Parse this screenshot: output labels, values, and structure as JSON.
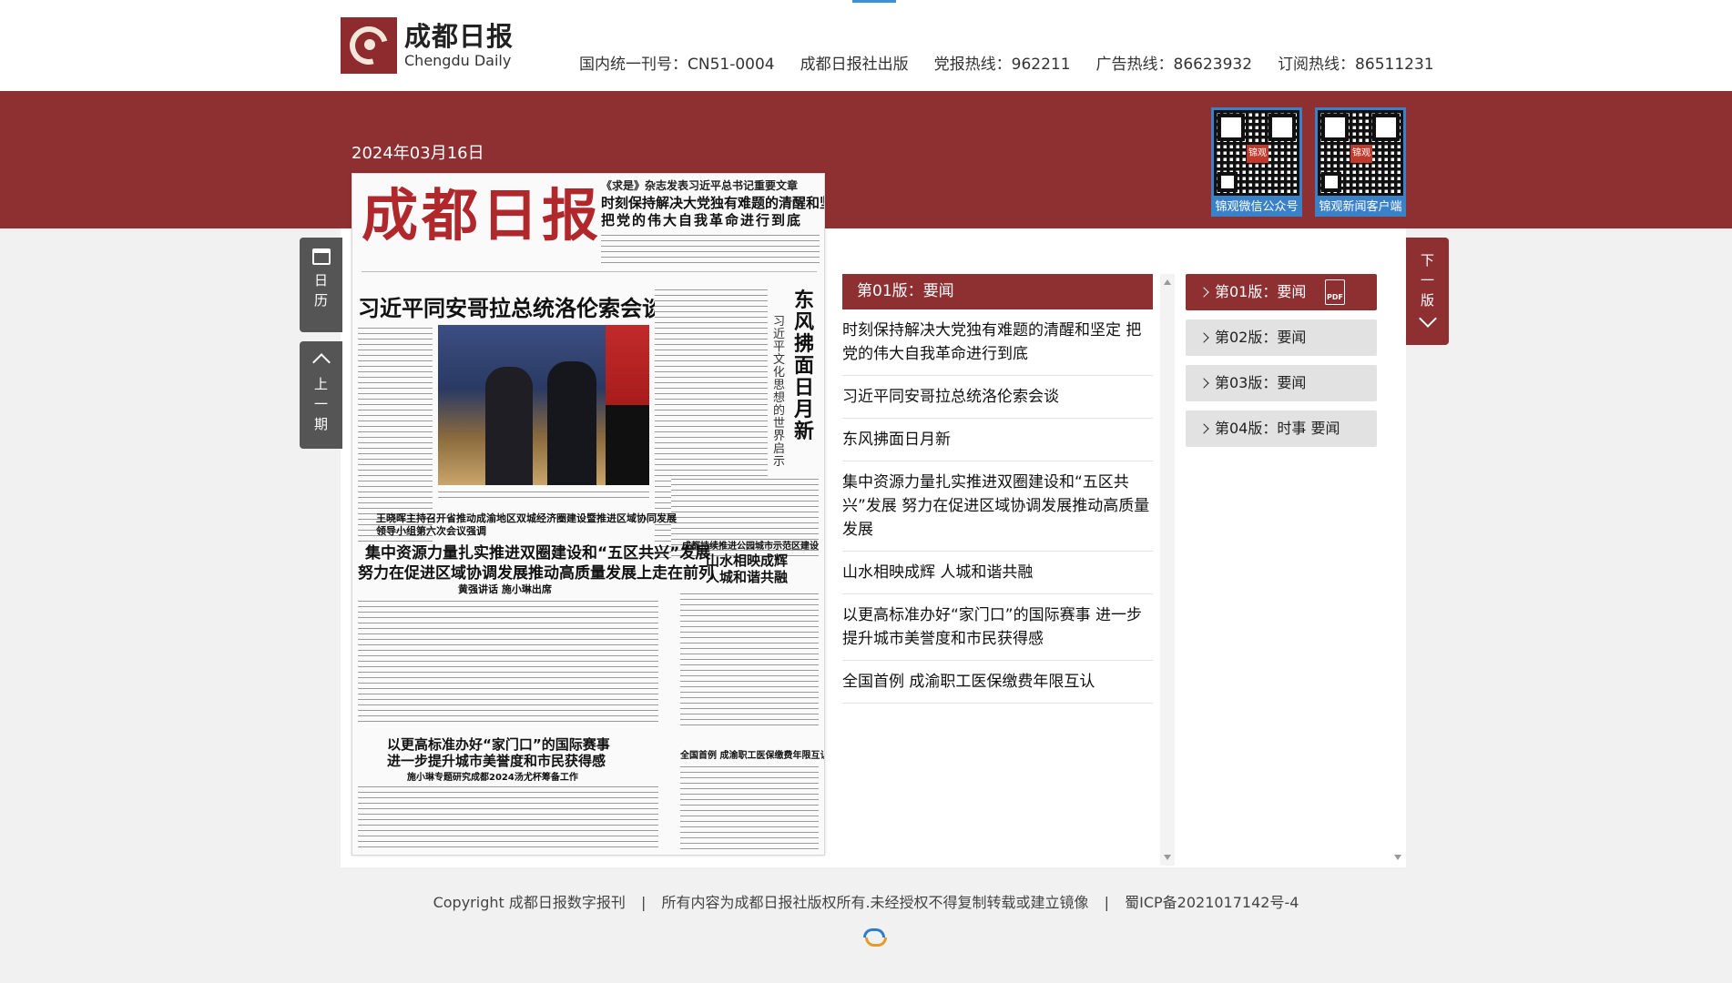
{
  "header": {
    "logo_cn": "成都日报",
    "logo_en": "Chengdu Daily",
    "hotlines": [
      "国内统一刊号：CN51-0004",
      "成都日报社出版",
      "党报热线：962211",
      "广告热线：86623932",
      "订阅热线：86511231"
    ]
  },
  "date": "2024年03月16日",
  "qr_codes": [
    {
      "caption": "锦观微信公众号",
      "seal": "锦观"
    },
    {
      "caption": "锦观新闻客户端",
      "seal": "锦观"
    }
  ],
  "side_buttons": {
    "calendar": [
      "日",
      "历"
    ],
    "prev": [
      "上",
      "一",
      "期"
    ],
    "next": [
      "下",
      "一",
      "版"
    ]
  },
  "paper": {
    "masthead": "成都日报",
    "kicker": "《求是》杂志发表习近平总书记重要文章",
    "lead_line1": "时刻保持解决大党独有难题的清醒和坚定",
    "lead_line2": "把党的伟大自我革命进行到底",
    "main_headline": "习近平同安哥拉总统洛伦索会谈",
    "vertical_title": "东风拂面日月新",
    "vertical_sub": "习近平文化思想的世界启示",
    "sub_kicker": "王晓晖主持召开省推动成渝地区双城经济圈建设暨推进区域协同发展领导小组第六次会议强调",
    "h2_line1": "集中资源力量扎实推进双圈建设和“五区共兴”发展",
    "h2_line2": "努力在促进区域协调发展推动高质量发展上走在前列",
    "h2_byline": "黄强讲话 施小琳出席",
    "side_kicker": "成都持续推进公园城市示范区建设",
    "side_h1": "山水相映成辉",
    "side_h2": "人城和谐共融",
    "h3_line1": "以更高标准办好“家门口”的国际赛事",
    "h3_line2": "进一步提升城市美誉度和市民获得感",
    "h3_byline": "施小琳专题研究成都2024汤尤杯筹备工作",
    "bottom_note": "全国首例 成渝职工医保缴费年限互认"
  },
  "list": {
    "header": "第01版：要闻",
    "items": [
      "时刻保持解决大党独有难题的清醒和坚定 把党的伟大自我革命进行到底",
      "习近平同安哥拉总统洛伦索会谈",
      "东风拂面日月新",
      "集中资源力量扎实推进双圈建设和“五区共兴”发展 努力在促进区域协调发展推动高质量发展",
      "山水相映成辉 人城和谐共融",
      "以更高标准办好“家门口”的国际赛事 进一步提升城市美誉度和市民获得感",
      "全国首例 成渝职工医保缴费年限互认"
    ]
  },
  "editions": [
    {
      "label": "第01版：要闻",
      "active": true
    },
    {
      "label": "第02版：要闻",
      "active": false
    },
    {
      "label": "第03版：要闻",
      "active": false
    },
    {
      "label": "第04版：时事 要闻",
      "active": false
    }
  ],
  "pdf_label": "PDF",
  "footer": [
    "Copyright 成都日报数字报刊",
    "|",
    "所有内容为成都日报社版权所有.未经授权不得复制转载或建立镜像",
    "|",
    "蜀ICP备2021017142号-4"
  ],
  "colors": {
    "brand": "#8e2f31",
    "qr_frame": "#3a82c8"
  }
}
